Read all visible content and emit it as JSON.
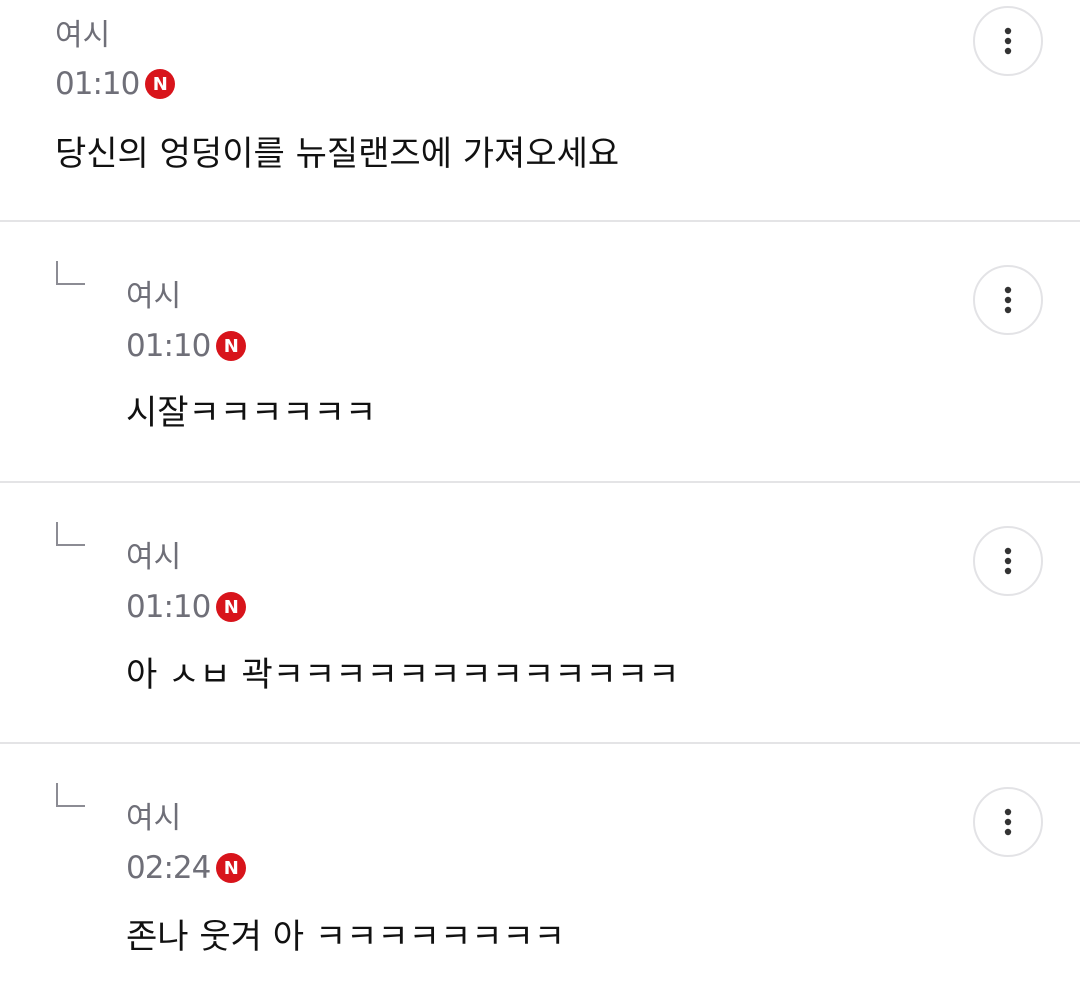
{
  "comments": [
    {
      "author": "여시",
      "time": "01:10",
      "badge": "N",
      "text": "당신의 엉덩이를 뉴질랜즈에 가져오세요",
      "is_reply": false,
      "more_icon": "more-vertical-icon"
    },
    {
      "author": "여시",
      "time": "01:10",
      "badge": "N",
      "text": "시잘ㅋㅋㅋㅋㅋㅋ",
      "is_reply": true,
      "more_icon": "more-vertical-icon"
    },
    {
      "author": "여시",
      "time": "01:10",
      "badge": "N",
      "text": "아 ㅅㅂ 곽ㅋㅋㅋㅋㅋㅋㅋㅋㅋㅋㅋㅋㅋ",
      "is_reply": true,
      "more_icon": "more-vertical-icon"
    },
    {
      "author": "여시",
      "time": "02:24",
      "badge": "N",
      "text": "존나 웃겨 아 ㅋㅋㅋㅋㅋㅋㅋㅋ",
      "is_reply": true,
      "more_icon": "more-vertical-icon"
    }
  ],
  "colors": {
    "badge": "#d8141b",
    "meta_text": "#6f6f78",
    "body_text": "#111111",
    "divider": "#e4e4e6"
  }
}
